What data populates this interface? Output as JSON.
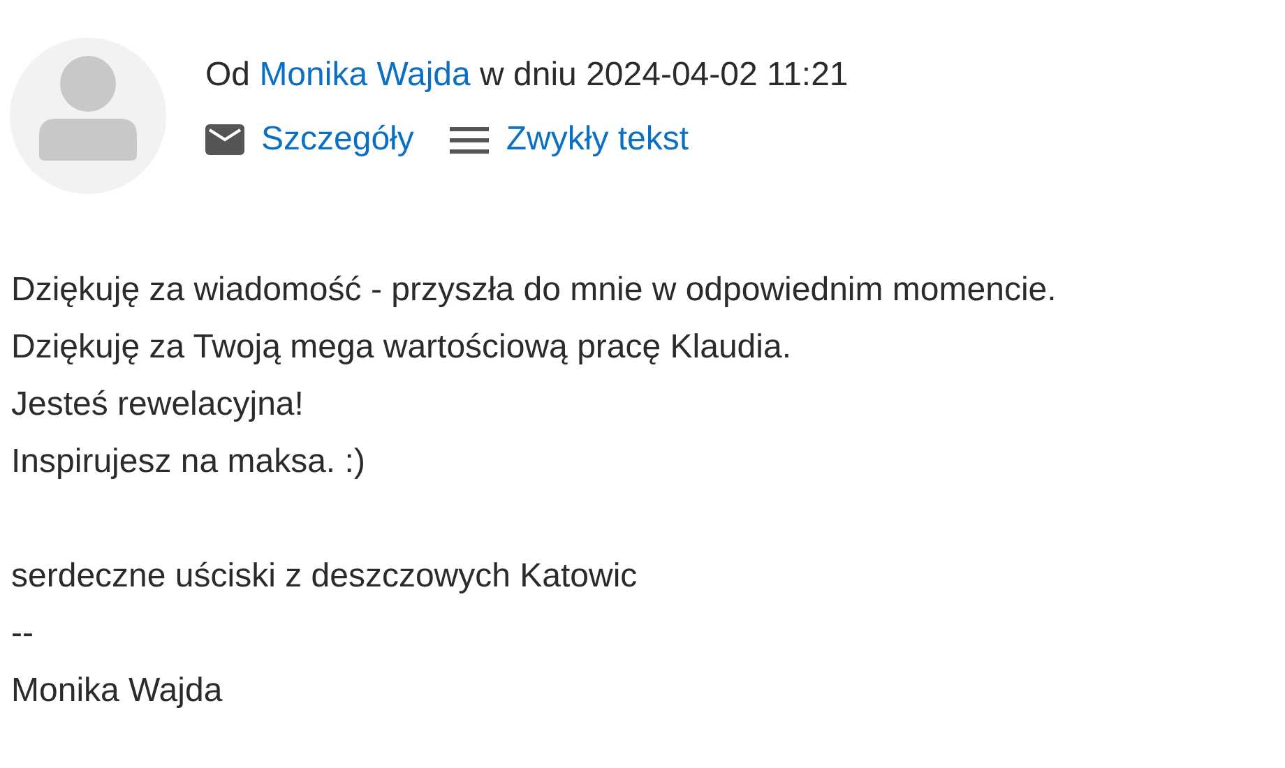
{
  "header": {
    "from_prefix": "Od",
    "sender": "Monika Wajda",
    "date_prefix": "w dniu",
    "date": "2024-04-02 11:21",
    "links": [
      {
        "kind": "details",
        "label": "Szczegóły"
      },
      {
        "kind": "plain",
        "label": "Zwykły tekst"
      }
    ]
  },
  "body": {
    "paragraphs": [
      [
        "Dziękuję za wiadomość - przyszła do mnie w odpowiednim momencie.",
        "Dziękuję za Twoją mega wartościową pracę Klaudia.",
        "Jesteś rewelacyjna!",
        "Inspirujesz na maksa. :)"
      ],
      [
        "serdeczne uściski z deszczowych Katowic",
        "--",
        "Monika Wajda"
      ]
    ]
  }
}
